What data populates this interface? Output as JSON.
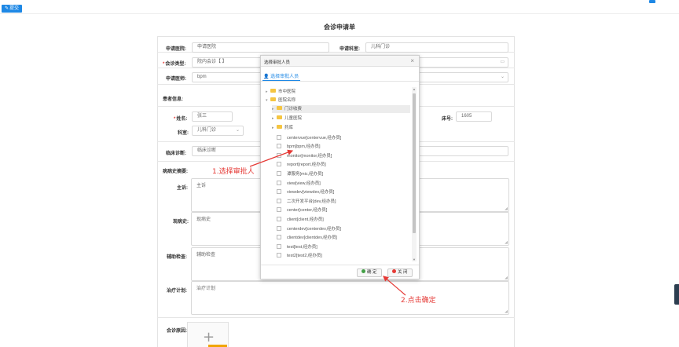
{
  "toolbar": {
    "submit_label": "提交",
    "submit_icon": "edit-icon"
  },
  "page": {
    "title": "会诊申请单"
  },
  "form": {
    "hospital_label": "申请医院:",
    "hospital_value": "申请医院",
    "dept_label": "申请科室:",
    "dept_value": "儿科门诊",
    "type_label": "会诊类型:",
    "type_value": "院内会诊【 】",
    "doctor_label": "申请医师:",
    "doctor_value": "bpm",
    "patient_section": "患者信息:",
    "name_label": "姓名:",
    "name_value": "张三",
    "bed_label": "床号:",
    "bed_value": "1605",
    "ward_label": "科室:",
    "ward_value": "儿科门诊",
    "diagnosis_label": "临床诊断:",
    "diagnosis_value": "临床诊断",
    "history_section": "病病史摘要:",
    "complaint_label": "主诉:",
    "complaint_value": "主诉",
    "present_label": "现病史:",
    "present_value": "现病史",
    "aux_label": "辅助检查:",
    "aux_value": "辅助检查",
    "plan_label": "治疗计划:",
    "plan_value": "治疗计划",
    "reason_label": "会诊原因:",
    "upload_plus": "+"
  },
  "modal": {
    "title": "选择审批人员",
    "close": "×",
    "tab": "选择审批人员",
    "tree": {
      "nodes": [
        "市中医院",
        "医院名称",
        "门诊收费",
        "儿童医院",
        "药库"
      ],
      "users": [
        "centervue[centervue,经办员]",
        "bpm[bpm,经办员]",
        "monitor[monitor,经办员]",
        "report[report,经办员]",
        "谭服务[mic,经办员]",
        "view[view,经办员]",
        "viewdev[viewdev,经办员]",
        "二次开发平台[dev,经办员]",
        "center[center,经办员]",
        "client[client,经办员]",
        "centerdev[centerdev,经办员]",
        "clientdev[clientdev,经办员]",
        "test[test,经办员]",
        "test2[test2,经办员]"
      ]
    },
    "ok_label": "确 定",
    "cancel_label": "关 闭",
    "ok_color": "#43a047",
    "cancel_color": "#e53935"
  },
  "annotations": {
    "step1": "1.选择审批人",
    "step2": "2.点击确定",
    "color": "#e53935"
  }
}
